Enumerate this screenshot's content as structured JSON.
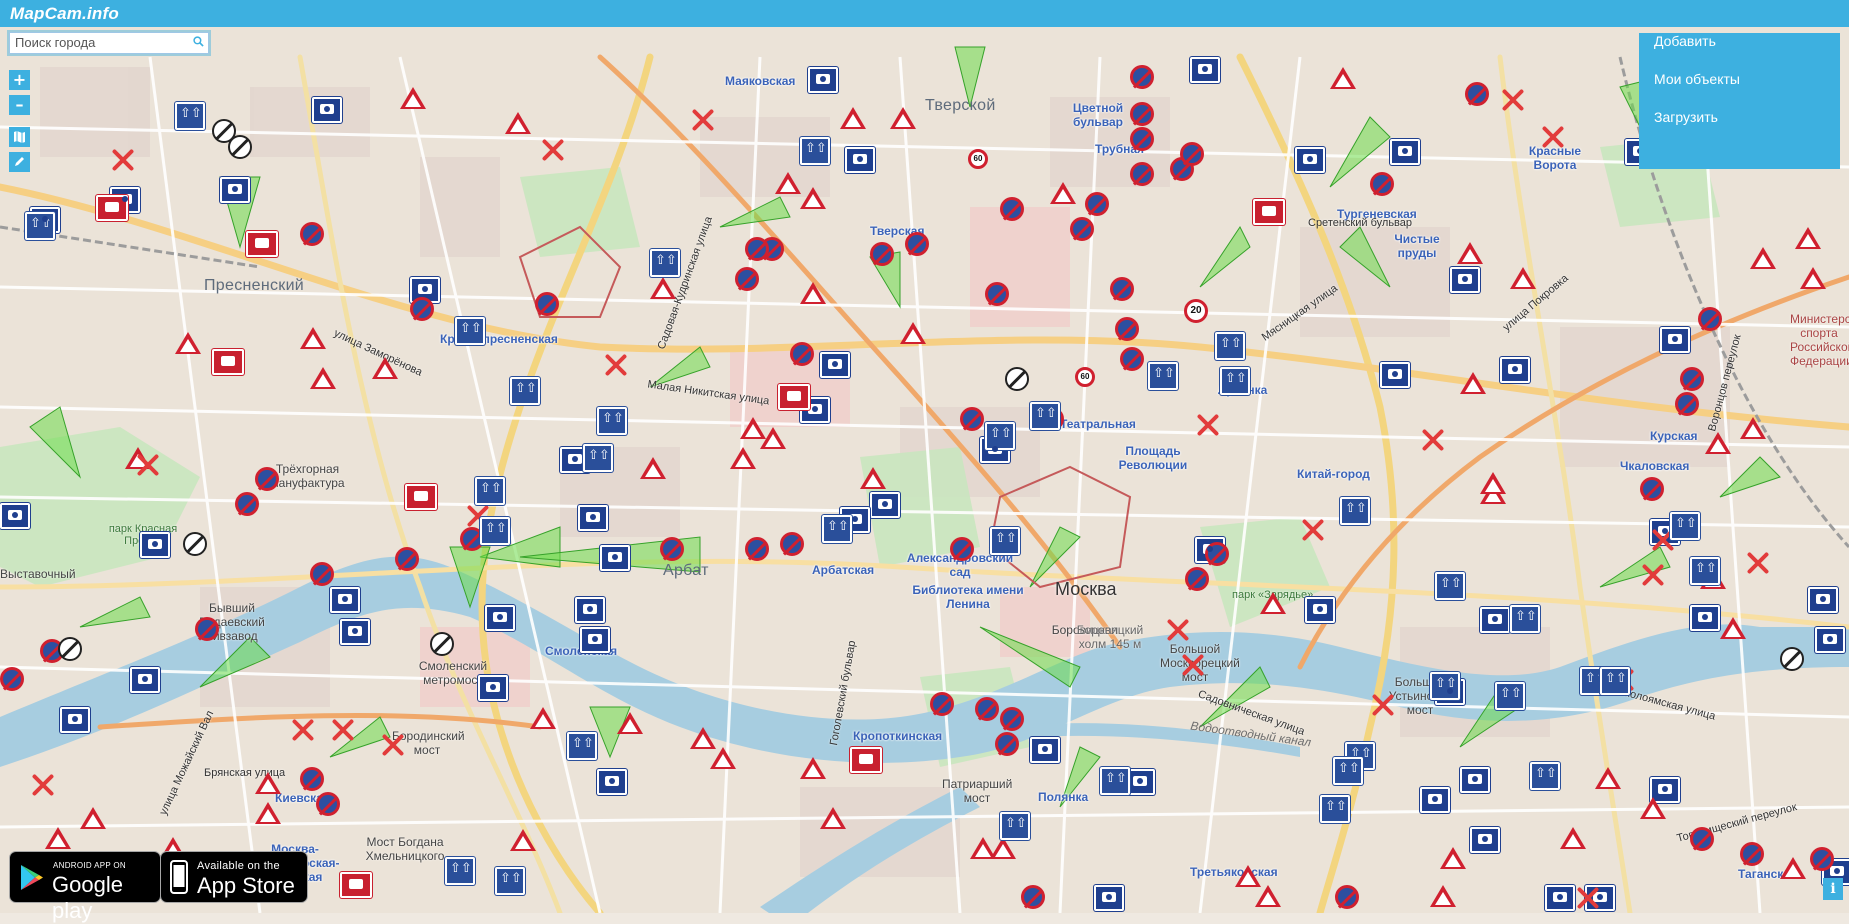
{
  "app": {
    "title": "MapCam.info"
  },
  "search": {
    "placeholder": "Поиск города",
    "icon": "search-icon"
  },
  "controls": {
    "zoom_in": "+",
    "zoom_out": "–"
  },
  "menu": {
    "items": [
      "Добавить",
      "Мои объекты",
      "Загрузить"
    ]
  },
  "badges": {
    "google_small": "ANDROID APP ON",
    "google_big": "Google play",
    "apple_small": "Available on the",
    "apple_big": "App Store"
  },
  "info_label": "i",
  "map": {
    "districts": [
      "Пресненский",
      "Тверской",
      "Арбат",
      "Москва"
    ],
    "metro": [
      "Маяковская",
      "Тверская",
      "Краснопресненская",
      "Арбатская",
      "Смоленская",
      "Александровский сад",
      "Библиотека имени Ленина",
      "Кропоткинская",
      "Театральная",
      "Площадь Революции",
      "Китай-город",
      "Тургеневская",
      "Чистые пруды",
      "Курская",
      "Чкаловская",
      "Красные Ворота",
      "Киевская",
      "Москва-Пассажирская-Киевская",
      "Третьяковская",
      "Таганская",
      "Лубянка",
      "Цветной бульвар",
      "Трубная",
      "Боровицкая",
      "Полянка"
    ],
    "streets": [
      "Малая Никитская улица",
      "улица Заморёнова",
      "Садовая-Кудринская улица",
      "Мясницкая улица",
      "улица Покровка",
      "Николоямская улица",
      "Садовническая улица",
      "Товарищеский переулок",
      "Брянская улица",
      "улица Можайский Вал",
      "Гоголевский бульвар",
      "Воронцов переулок",
      "Сретенский бульвар",
      "Бородинский мост",
      "Смоленский метромост",
      "Большой Москворецкий мост",
      "Большой Устьинский мост",
      "Патриарший мост",
      "Мост Богдана Хмельницкого",
      "Водоотводный канал"
    ],
    "places": [
      "Трёхгорная мануфактура",
      "парк Красная Пресня",
      "Выставочный",
      "Бывший Бадаевский пивзавод",
      "парк «Зарядье»",
      "Боровицкий холм 145 м",
      "Министерство спорта Российской Федерации"
    ],
    "speed_limits": [
      "20",
      "60",
      "60"
    ]
  }
}
